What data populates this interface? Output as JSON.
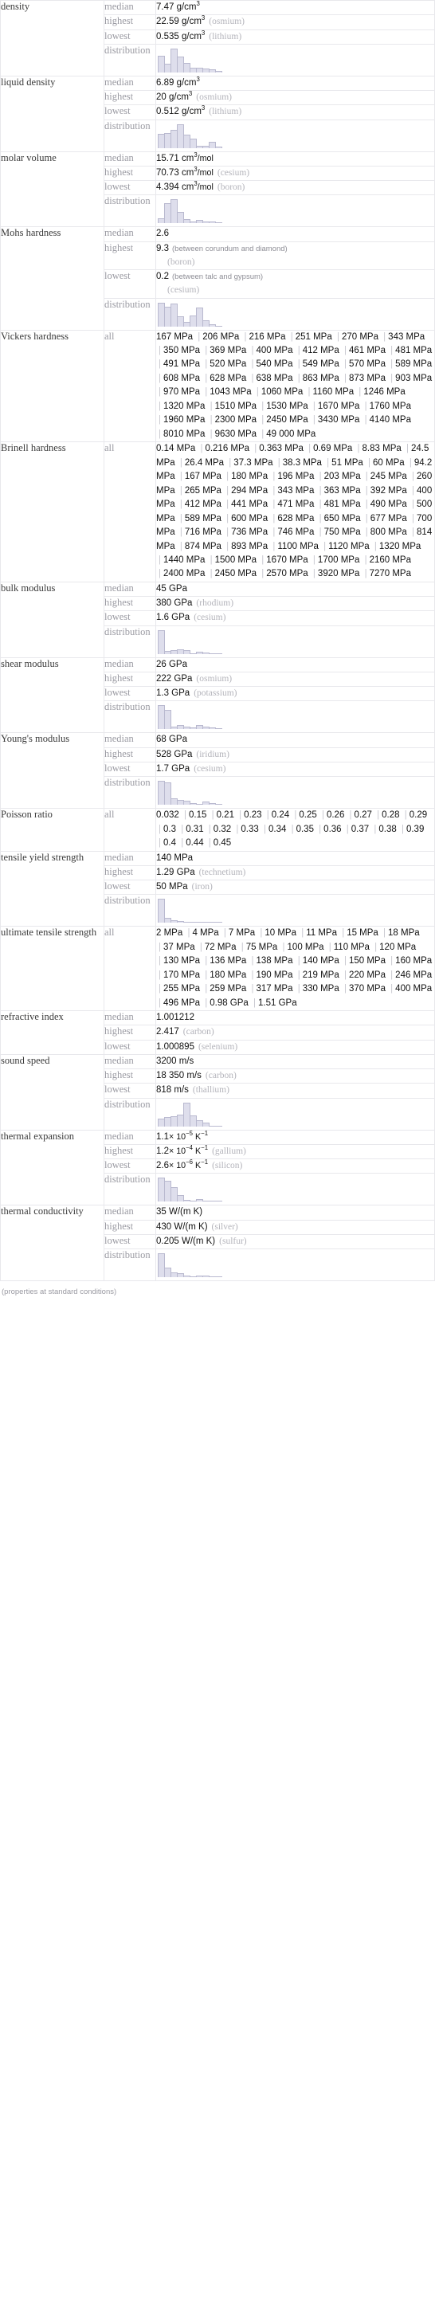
{
  "footnote": "(properties at standard conditions)",
  "labels": {
    "median": "median",
    "highest": "highest",
    "lowest": "lowest",
    "distribution": "distribution",
    "all": "all"
  },
  "colors": {
    "bar_fill": "#dedeec",
    "bar_stroke": "#b9b9cf",
    "muted": "#9a9aa2",
    "value": "#111111"
  },
  "rows": [
    {
      "name": "density",
      "median": {
        "value": "7.47 g/cm",
        "sup": "3"
      },
      "highest": {
        "value": "22.59 g/cm",
        "sup": "3",
        "qual": "(osmium)"
      },
      "lowest": {
        "value": "0.535 g/cm",
        "sup": "3",
        "qual": "(lithium)"
      },
      "distribution": [
        20,
        11,
        29,
        19,
        12,
        6,
        6,
        5,
        4,
        2
      ]
    },
    {
      "name": "liquid density",
      "median": {
        "value": "6.89 g/cm",
        "sup": "3"
      },
      "highest": {
        "value": "20 g/cm",
        "sup": "3",
        "qual": "(osmium)"
      },
      "lowest": {
        "value": "0.512 g/cm",
        "sup": "3",
        "qual": "(lithium)"
      },
      "distribution": [
        17,
        18,
        22,
        29,
        16,
        12,
        3,
        3,
        8,
        2
      ]
    },
    {
      "name": "molar volume",
      "median": {
        "value": "15.71 cm",
        "sup": "3",
        "tail": "/mol"
      },
      "highest": {
        "value": "70.73 cm",
        "sup": "3",
        "tail": "/mol",
        "qual": "(cesium)"
      },
      "lowest": {
        "value": "4.394 cm",
        "sup": "3",
        "tail": "/mol",
        "qual": "(boron)"
      },
      "distribution": [
        6,
        24,
        29,
        14,
        5,
        2,
        4,
        2,
        2,
        0
      ]
    },
    {
      "name": "Mohs hardness",
      "median": {
        "value": "2.6"
      },
      "highest": {
        "value": "9.3",
        "qual2": "(between corundum and diamond)",
        "qual_block": "(boron)"
      },
      "lowest": {
        "value": "0.2",
        "qual2": "(between talc and gypsum)",
        "qual_block": "(cesium)"
      },
      "distribution": [
        30,
        25,
        29,
        13,
        6,
        14,
        24,
        8,
        3,
        1
      ]
    },
    {
      "name": "Vickers hardness",
      "all": [
        "167 MPa",
        "206 MPa",
        "216 MPa",
        "251 MPa",
        "270 MPa",
        "343 MPa",
        "350 MPa",
        "369 MPa",
        "400 MPa",
        "412 MPa",
        "461 MPa",
        "481 MPa",
        "491 MPa",
        "520 MPa",
        "540 MPa",
        "549 MPa",
        "570 MPa",
        "589 MPa",
        "608 MPa",
        "628 MPa",
        "638 MPa",
        "863 MPa",
        "873 MPa",
        "903 MPa",
        "970 MPa",
        "1043 MPa",
        "1060 MPa",
        "1160 MPa",
        "1246 MPa",
        "1320 MPa",
        "1510 MPa",
        "1530 MPa",
        "1670 MPa",
        "1760 MPa",
        "1960 MPa",
        "2300 MPa",
        "2450 MPa",
        "3430 MPa",
        "4140 MPa",
        "8010 MPa",
        "9630 MPa",
        "49 000 MPa"
      ]
    },
    {
      "name": "Brinell hardness",
      "all": [
        "0.14 MPa",
        "0.216 MPa",
        "0.363 MPa",
        "0.69 MPa",
        "8.83 MPa",
        "24.5 MPa",
        "26.4 MPa",
        "37.3 MPa",
        "38.3 MPa",
        "51 MPa",
        "60 MPa",
        "94.2 MPa",
        "167 MPa",
        "180 MPa",
        "196 MPa",
        "203 MPa",
        "245 MPa",
        "260 MPa",
        "265 MPa",
        "294 MPa",
        "343 MPa",
        "363 MPa",
        "392 MPa",
        "400 MPa",
        "412 MPa",
        "441 MPa",
        "471 MPa",
        "481 MPa",
        "490 MPa",
        "500 MPa",
        "589 MPa",
        "600 MPa",
        "628 MPa",
        "650 MPa",
        "677 MPa",
        "700 MPa",
        "716 MPa",
        "736 MPa",
        "746 MPa",
        "750 MPa",
        "800 MPa",
        "814 MPa",
        "874 MPa",
        "893 MPa",
        "1100 MPa",
        "1120 MPa",
        "1320 MPa",
        "1440 MPa",
        "1500 MPa",
        "1670 MPa",
        "1700 MPa",
        "2160 MPa",
        "2400 MPa",
        "2450 MPa",
        "2570 MPa",
        "3920 MPa",
        "7270 MPa"
      ]
    },
    {
      "name": "bulk modulus",
      "median": {
        "value": "45 GPa"
      },
      "highest": {
        "value": "380 GPa",
        "qual": "(rhodium)"
      },
      "lowest": {
        "value": "1.6 GPa",
        "qual": "(cesium)"
      },
      "distribution": [
        30,
        4,
        5,
        6,
        5,
        1,
        3,
        2,
        0,
        0
      ]
    },
    {
      "name": "shear modulus",
      "median": {
        "value": "26 GPa"
      },
      "highest": {
        "value": "222 GPa",
        "qual": "(osmium)"
      },
      "lowest": {
        "value": "1.3 GPa",
        "qual": "(potassium)"
      },
      "distribution": [
        30,
        24,
        3,
        5,
        3,
        2,
        5,
        3,
        2,
        0
      ]
    },
    {
      "name": "Young's modulus",
      "median": {
        "value": "68 GPa"
      },
      "highest": {
        "value": "528 GPa",
        "qual": "(iridium)"
      },
      "lowest": {
        "value": "1.7 GPa",
        "qual": "(cesium)"
      },
      "distribution": [
        30,
        28,
        8,
        6,
        5,
        2,
        0,
        4,
        2,
        0
      ]
    },
    {
      "name": "Poisson ratio",
      "all": [
        "0.032",
        "0.15",
        "0.21",
        "0.23",
        "0.24",
        "0.25",
        "0.26",
        "0.27",
        "0.28",
        "0.29",
        "0.3",
        "0.31",
        "0.32",
        "0.33",
        "0.34",
        "0.35",
        "0.36",
        "0.37",
        "0.38",
        "0.39",
        "0.4",
        "0.44",
        "0.45"
      ]
    },
    {
      "name": "tensile yield strength",
      "median": {
        "value": "140 MPa"
      },
      "highest": {
        "value": "1.29 GPa",
        "qual": "(technetium)"
      },
      "lowest": {
        "value": "50 MPa",
        "qual": "(iron)"
      },
      "distribution": [
        30,
        6,
        3,
        2,
        1,
        1,
        0,
        0,
        0,
        0
      ]
    },
    {
      "name": "ultimate tensile strength",
      "all": [
        "2 MPa",
        "4 MPa",
        "7 MPa",
        "10 MPa",
        "11 MPa",
        "15 MPa",
        "18 MPa",
        "37 MPa",
        "72 MPa",
        "75 MPa",
        "100 MPa",
        "110 MPa",
        "120 MPa",
        "130 MPa",
        "136 MPa",
        "138 MPa",
        "140 MPa",
        "150 MPa",
        "160 MPa",
        "170 MPa",
        "180 MPa",
        "190 MPa",
        "219 MPa",
        "220 MPa",
        "246 MPa",
        "255 MPa",
        "259 MPa",
        "317 MPa",
        "330 MPa",
        "370 MPa",
        "400 MPa",
        "496 MPa",
        "0.98 GPa",
        "1.51 GPa"
      ]
    },
    {
      "name": "refractive index",
      "median": {
        "value": "1.001212"
      },
      "highest": {
        "value": "2.417",
        "qual": "(carbon)"
      },
      "lowest": {
        "value": "1.000895",
        "qual": "(selenium)"
      }
    },
    {
      "name": "sound speed",
      "median": {
        "value": "3200 m/s"
      },
      "highest": {
        "value": "18 350 m/s",
        "qual": "(carbon)"
      },
      "lowest": {
        "value": "818 m/s",
        "qual": "(thallium)"
      },
      "distribution": [
        10,
        12,
        13,
        15,
        30,
        14,
        8,
        5,
        1,
        1
      ]
    },
    {
      "name": "thermal expansion",
      "median": {
        "value": "1.1",
        "mult": "× 10",
        "exp": "−5",
        "tail": " K",
        "tailsup": "−1"
      },
      "highest": {
        "value": "1.2",
        "mult": "× 10",
        "exp": "−4",
        "tail": " K",
        "tailsup": "−1",
        "qual": "(gallium)"
      },
      "lowest": {
        "value": "2.6",
        "mult": "× 10",
        "exp": "−6",
        "tail": " K",
        "tailsup": "−1",
        "qual": "(silicon)"
      },
      "distribution": [
        30,
        26,
        18,
        8,
        2,
        0,
        3,
        0,
        0,
        0
      ]
    },
    {
      "name": "thermal conductivity",
      "median": {
        "value": "35 W/(m K)"
      },
      "highest": {
        "value": "430 W/(m K)",
        "qual": "(silver)"
      },
      "lowest": {
        "value": "0.205 W/(m K)",
        "qual": "(sulfur)"
      },
      "distribution": [
        30,
        12,
        6,
        5,
        2,
        0,
        2,
        2,
        0,
        0
      ]
    }
  ]
}
